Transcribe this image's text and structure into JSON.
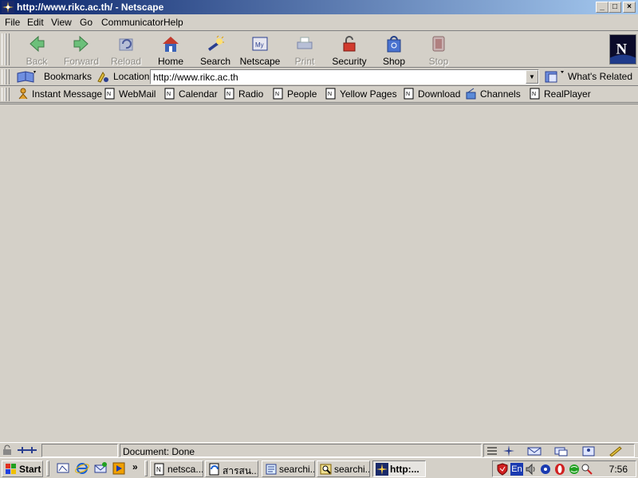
{
  "window": {
    "title": "http://www.rikc.ac.th/ - Netscape",
    "controls": [
      "_",
      "□",
      "×"
    ]
  },
  "menu": [
    {
      "label": "File"
    },
    {
      "label": "Edit"
    },
    {
      "label": "View"
    },
    {
      "label": "Go"
    },
    {
      "label": "Communicator"
    },
    {
      "label": "Help"
    }
  ],
  "nav_toolbar": {
    "back": "Back",
    "forward": "Forward",
    "reload": "Reload",
    "home": "Home",
    "search": "Search",
    "netscape": "Netscape",
    "print": "Print",
    "security": "Security",
    "shop": "Shop",
    "stop": "Stop"
  },
  "location_bar": {
    "bookmarks": "Bookmarks",
    "location_label": "Location:",
    "url": "http://www.rikc.ac.th",
    "whats_related": "What's Related"
  },
  "personal_toolbar": {
    "instant_message": "Instant Message",
    "webmail": "WebMail",
    "calendar": "Calendar",
    "radio": "Radio",
    "people": "People",
    "yellow_pages": "Yellow Pages",
    "download": "Download",
    "channels": "Channels",
    "realplayer": "RealPlayer"
  },
  "status": {
    "text": "Document: Done"
  },
  "taskbar": {
    "start": "Start",
    "more": "»",
    "buttons": [
      {
        "label": "netsca..."
      },
      {
        "label": "สารสน..."
      },
      {
        "label": "searchi..."
      },
      {
        "label": "searchi..."
      },
      {
        "label": "http:..."
      }
    ],
    "lang": "En",
    "clock": "7:56"
  },
  "colors": {
    "titlebar_start": "#0a246a",
    "titlebar_end": "#a6caf0",
    "face": "#d4d0c8"
  }
}
